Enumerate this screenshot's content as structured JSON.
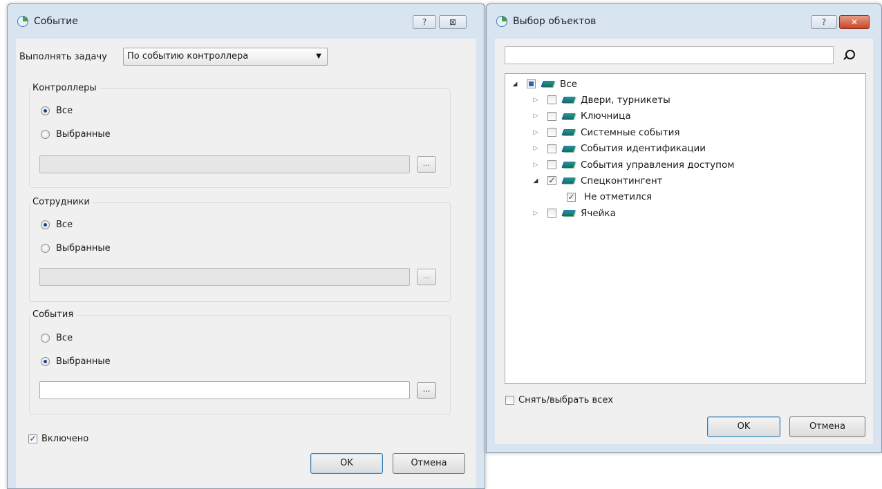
{
  "event_dialog": {
    "title": "Событие",
    "help_label": "?",
    "close_label": "⊠",
    "execute_label": "Выполнять задачу",
    "execute_value": "По событию контроллера",
    "controllers": {
      "title": "Контроллеры",
      "option_all": "Все",
      "option_selected": "Выбранные",
      "selected_option": "all",
      "browse_label": "..."
    },
    "employees": {
      "title": "Сотрудники",
      "option_all": "Все",
      "option_selected": "Выбранные",
      "selected_option": "all",
      "browse_label": "..."
    },
    "events": {
      "title": "События",
      "option_all": "Все",
      "option_selected": "Выбранные",
      "selected_option": "selected",
      "browse_label": "..."
    },
    "enabled_label": "Включено",
    "enabled_checked": true,
    "ok_label": "OK",
    "cancel_label": "Отмена"
  },
  "select_dialog": {
    "title": "Выбор объектов",
    "help_label": "?",
    "close_label": "✕",
    "search_value": "",
    "tree": [
      {
        "label": "Все",
        "level": 0,
        "expand": "open",
        "check": "partial",
        "folder": true
      },
      {
        "label": "Двери, турникеты",
        "level": 1,
        "expand": "closed",
        "check": "off",
        "folder": true
      },
      {
        "label": "Ключница",
        "level": 1,
        "expand": "closed",
        "check": "off",
        "folder": true
      },
      {
        "label": "Системные события",
        "level": 1,
        "expand": "closed",
        "check": "off",
        "folder": true
      },
      {
        "label": "События идентификации",
        "level": 1,
        "expand": "closed",
        "check": "off",
        "folder": true
      },
      {
        "label": "События управления доступом",
        "level": 1,
        "expand": "closed",
        "check": "off",
        "folder": true
      },
      {
        "label": "Спецконтингент",
        "level": 1,
        "expand": "open",
        "check": "on",
        "folder": true
      },
      {
        "label": "Не отметился",
        "level": 2,
        "expand": "none",
        "check": "on",
        "folder": false
      },
      {
        "label": "Ячейка",
        "level": 1,
        "expand": "closed",
        "check": "off",
        "folder": true
      }
    ],
    "select_all_label": "Снять/выбрать всех",
    "select_all_checked": false,
    "ok_label": "OK",
    "cancel_label": "Отмена"
  },
  "glyphs": {
    "check_mark": "✓",
    "combo_arrow": "▼",
    "expand_open": "◢",
    "expand_closed": "▷"
  }
}
